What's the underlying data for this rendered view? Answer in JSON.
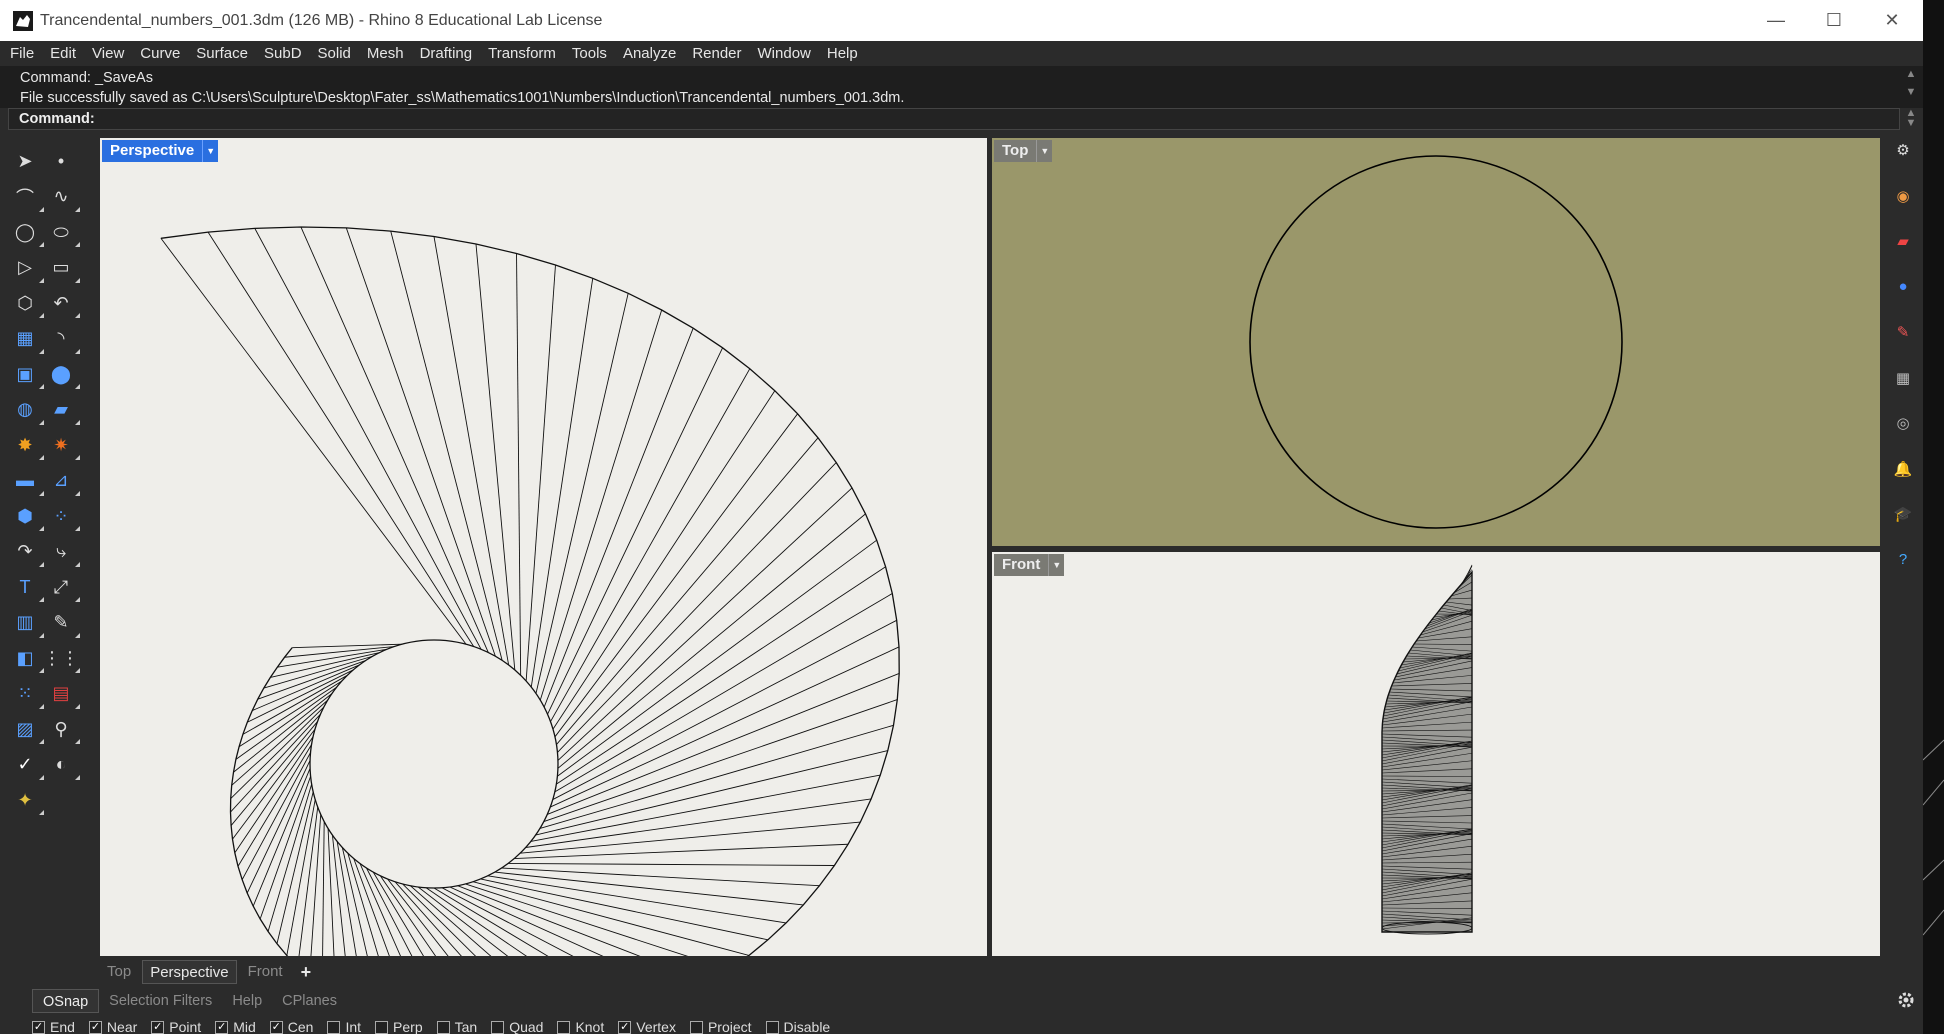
{
  "window": {
    "title": "Trancendental_numbers_001.3dm (126 MB) - Rhino 8 Educational Lab License",
    "controls": {
      "minimize": "—",
      "maximize": "☐",
      "close": "✕"
    }
  },
  "menu": [
    "File",
    "Edit",
    "View",
    "Curve",
    "Surface",
    "SubD",
    "Solid",
    "Mesh",
    "Drafting",
    "Transform",
    "Tools",
    "Analyze",
    "Render",
    "Window",
    "Help"
  ],
  "command_history": [
    "Command: _SaveAs",
    "File successfully saved as C:\\Users\\Sculpture\\Desktop\\Fater_ss\\Mathematics1001\\Numbers\\Induction\\Trancendental_numbers_001.3dm."
  ],
  "command_prompt": "Command:",
  "viewports": {
    "perspective": {
      "label": "Perspective",
      "active": true
    },
    "top": {
      "label": "Top",
      "active": false
    },
    "front": {
      "label": "Front",
      "active": false
    }
  },
  "viewport_tabs": [
    {
      "label": "Top",
      "active": false
    },
    {
      "label": "Perspective",
      "active": true
    },
    {
      "label": "Front",
      "active": false
    }
  ],
  "add_tab_label": "+",
  "status_tabs": [
    {
      "label": "OSnap",
      "active": true
    },
    {
      "label": "Selection Filters",
      "active": false
    },
    {
      "label": "Help",
      "active": false
    },
    {
      "label": "CPlanes",
      "active": false
    }
  ],
  "osnaps": [
    {
      "label": "End",
      "checked": true
    },
    {
      "label": "Near",
      "checked": true
    },
    {
      "label": "Point",
      "checked": true
    },
    {
      "label": "Mid",
      "checked": true
    },
    {
      "label": "Cen",
      "checked": true
    },
    {
      "label": "Int",
      "checked": false
    },
    {
      "label": "Perp",
      "checked": false
    },
    {
      "label": "Tan",
      "checked": false
    },
    {
      "label": "Quad",
      "checked": false
    },
    {
      "label": "Knot",
      "checked": false
    },
    {
      "label": "Vertex",
      "checked": true
    },
    {
      "label": "Project",
      "checked": false
    },
    {
      "label": "Disable",
      "checked": false
    }
  ],
  "colors": {
    "accent": "#2a6fe0",
    "viewport_bg": "#efeeea",
    "top_view_bg": "#9a976a",
    "ui_dark": "#2b2b2b"
  },
  "left_tools": [
    "select-arrow-icon",
    "point-icon",
    "polyline-icon",
    "curve-icon",
    "circle-icon",
    "ellipse-icon",
    "polygon-icon",
    "rectangle-icon",
    "hexagon-icon",
    "arc-icon",
    "surface-grid-icon",
    "fillet-icon",
    "box-icon",
    "boolean-icon",
    "cylinder-icon",
    "plane-icon",
    "explode-icon",
    "burst-icon",
    "dimension-icon",
    "cut-icon",
    "solid-union-icon",
    "points-cloud-icon",
    "rotate-icon",
    "blend-icon",
    "text-icon",
    "scale-icon",
    "array-icon",
    "edit-icon",
    "block-icon",
    "grid-snap-icon",
    "points-grid-icon",
    "red-grid-icon",
    "layer-icon",
    "tree-icon",
    "check-icon",
    "shade-icon",
    "paint-icon"
  ],
  "right_panel_icons": [
    "gear-icon",
    "color-wheel-icon",
    "layers-icon",
    "material-ball-icon",
    "brush-icon",
    "texture-icon",
    "camera-icon",
    "bell-icon",
    "graduation-cap-icon",
    "help-icon"
  ],
  "settings_icon": "gear-icon"
}
